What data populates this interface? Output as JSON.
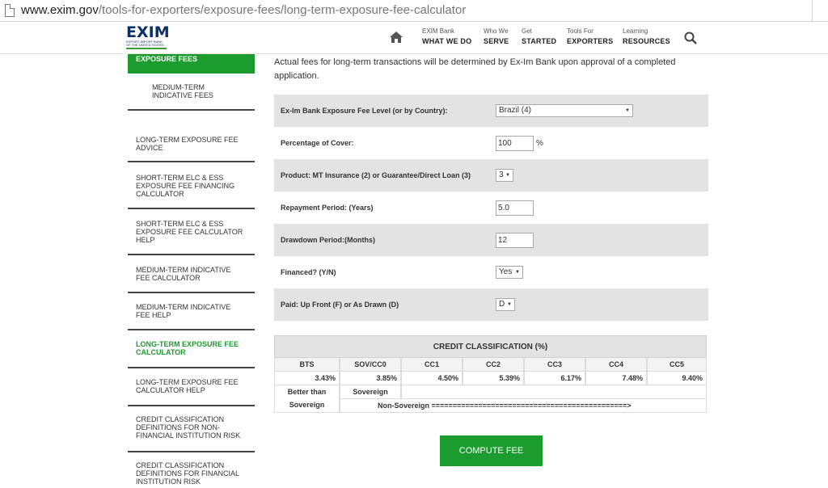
{
  "browser": {
    "url_host": "www.exim.gov",
    "url_path": "/tools-for-exporters/exposure-fees/long-term-exposure-fee-calculator"
  },
  "header": {
    "logo_text": "EXIM",
    "logo_sub": "EXPORT-IMPORT BANK OF THE UNITED STATES",
    "nav": [
      {
        "small": "EXIM Bank",
        "big": "WHAT WE DO"
      },
      {
        "small": "Who We",
        "big": "SERVE"
      },
      {
        "small": "Get",
        "big": "STARTED"
      },
      {
        "small": "Tools For",
        "big": "EXPORTERS"
      },
      {
        "small": "Learning",
        "big": "RESOURCES"
      }
    ],
    "icons": {
      "home": "home-icon",
      "search": "search-icon"
    }
  },
  "sidebar": {
    "active_parent": "EXPOSURE FEES",
    "items": [
      {
        "label": "MEDIUM-TERM INDICATIVE FEES"
      },
      {
        "label": "LONG-TERM EXPOSURE FEE ADVICE"
      },
      {
        "label": "SHORT-TERM ELC & ESS EXPOSURE FEE FINANCING CALCULATOR"
      },
      {
        "label": "SHORT-TERM ELC & ESS EXPOSURE FEE CALCULATOR HELP"
      },
      {
        "label": "MEDIUM-TERM INDICATIVE FEE CALCULATOR"
      },
      {
        "label": "MEDIUM-TERM INDICATIVE FEE HELP"
      },
      {
        "label": "LONG-TERM EXPOSURE FEE CALCULATOR"
      },
      {
        "label": "LONG-TERM EXPOSURE FEE CALCULATOR HELP"
      },
      {
        "label": "CREDIT CLASSIFICATION DEFINITIONS FOR NON-FINANCIAL INSTITUTION RISK"
      },
      {
        "label": "CREDIT CLASSIFICATION DEFINITIONS FOR FINANCIAL INSTITUTION RISK"
      }
    ]
  },
  "main": {
    "intro": "Actual fees for long-term transactions will be determined by Ex-Im Bank upon approval of a completed application.",
    "form": {
      "country_label": "Ex-Im Bank Exposure Fee Level (or by Country):",
      "country_value": "Brazil (4)",
      "cover_label": "Percentage of Cover:",
      "cover_value": "100",
      "cover_unit": "%",
      "product_label": "Product: MT Insurance (2) or Guarantee/Direct Loan (3)",
      "product_value": "3",
      "repayment_label": "Repayment Period: (Years)",
      "repayment_value": "5.0",
      "drawdown_label": "Drawdown Period:(Months)",
      "drawdown_value": "12",
      "financed_label": "Financed? (Y/N)",
      "financed_value": "Yes",
      "paid_label": "Paid: Up Front (F) or As Drawn (D)",
      "paid_value": "D"
    },
    "credit": {
      "title": "CREDIT CLASSIFICATION (%)",
      "columns": [
        "BTS",
        "SOV/CC0",
        "CC1",
        "CC2",
        "CC3",
        "CC4",
        "CC5"
      ],
      "values": [
        "3.43%",
        "3.85%",
        "4.50%",
        "5.39%",
        "6.17%",
        "7.48%",
        "9.40%"
      ],
      "legend_better_line1": "Better than",
      "legend_better_line2": "Sovereign",
      "legend_sovereign": "Sovereign",
      "legend_non_sovereign": "Non-Sovereign ==============================================>"
    },
    "compute_label": "COMPUTE FEE"
  }
}
